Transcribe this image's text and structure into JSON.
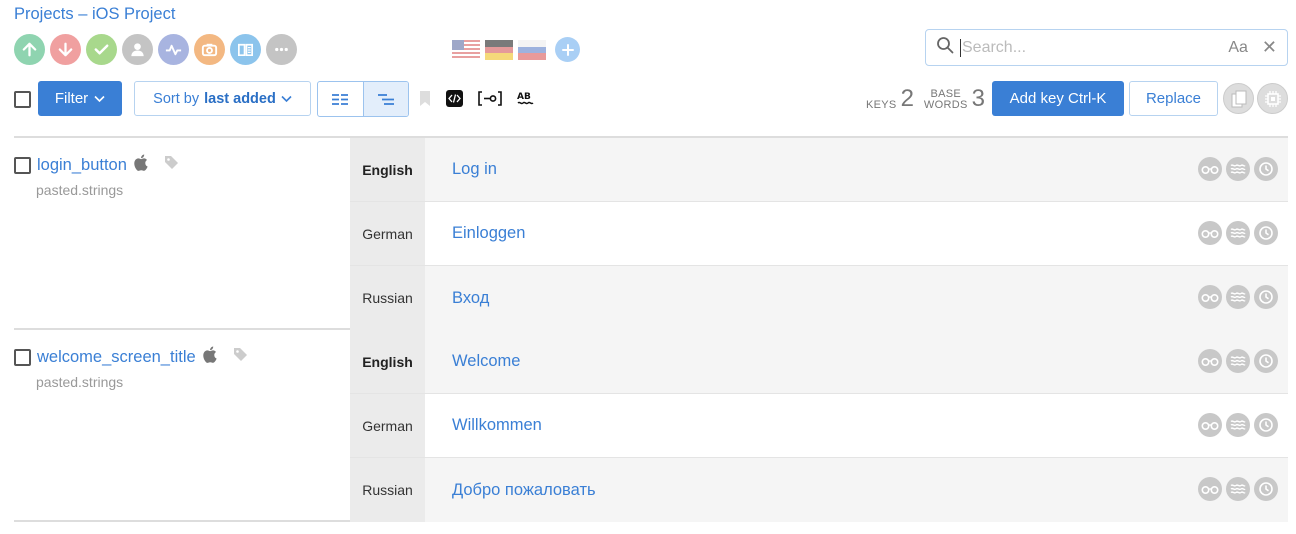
{
  "breadcrumb": {
    "projects": "Projects",
    "separator": " – ",
    "project": "iOS Project"
  },
  "top_icons": [
    {
      "name": "upload-icon",
      "color": "#8fd4b0"
    },
    {
      "name": "download-icon",
      "color": "#f0a0a0"
    },
    {
      "name": "check-icon",
      "color": "#a8d88c"
    },
    {
      "name": "user-icon",
      "color": "#c4c4c4"
    },
    {
      "name": "activity-icon",
      "color": "#a8b4e0"
    },
    {
      "name": "camera-icon",
      "color": "#f3b882"
    },
    {
      "name": "book-icon",
      "color": "#8cc4ec"
    },
    {
      "name": "more-icon",
      "color": "#c4c4c4"
    }
  ],
  "languages": [
    "English",
    "German",
    "Russian"
  ],
  "search": {
    "placeholder": "Search...",
    "case_label": "Aa",
    "clear": "✕"
  },
  "toolbar": {
    "filter_label": "Filter",
    "sort_prefix": "Sort by ",
    "sort_value": "last added",
    "stats": {
      "keys_label": "KEYS",
      "keys_value": "2",
      "words_label_1": "BASE",
      "words_label_2": "WORDS",
      "words_value": "3"
    },
    "add_key_label": "Add key Ctrl-K",
    "replace_label": "Replace"
  },
  "colors": {
    "accent": "#3a7fd5"
  },
  "keys": [
    {
      "name": "login_button",
      "file": "pasted.strings",
      "translations": [
        {
          "lang": "English",
          "value": "Log in"
        },
        {
          "lang": "German",
          "value": "Einloggen"
        },
        {
          "lang": "Russian",
          "value": "Вход"
        }
      ]
    },
    {
      "name": "welcome_screen_title",
      "file": "pasted.strings",
      "translations": [
        {
          "lang": "English",
          "value": "Welcome"
        },
        {
          "lang": "German",
          "value": "Willkommen"
        },
        {
          "lang": "Russian",
          "value": "Добро пожаловать"
        }
      ]
    }
  ]
}
